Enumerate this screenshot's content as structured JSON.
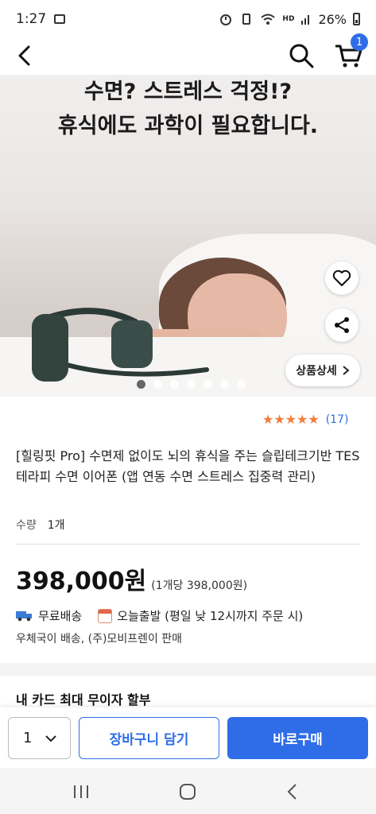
{
  "status_bar": {
    "time": "1:27",
    "battery": "26%",
    "hd_label": "HD"
  },
  "nav": {
    "cart_count": "1"
  },
  "hero": {
    "headline_line1": "수면? 스트레스 걱정!?",
    "headline_line2": "휴식에도 과학이 필요합니다.",
    "detail_button": "상품상세",
    "page_dots": 7,
    "active_dot": 0
  },
  "product": {
    "rating_stars": 5,
    "review_count": "(17)",
    "title": "[힐링핏 Pro] 수면제 없이도 뇌의 휴식을 주는 슬립테크기반 TES 테라피 수면 이어폰 (앱 연동 수면 스트레스 집중력 관리)",
    "qty_label": "수량",
    "qty_value": "1개",
    "price": "398,000원",
    "unit_price": "(1개당 398,000원)",
    "free_shipping": "무료배송",
    "today_ship": "오늘출발 (평일 낮 12시까지 주문 시)",
    "seller": "우체국이 배송, (주)모비프렌이 판매"
  },
  "card_section": {
    "title": "내 카드 최대 무이자 할부"
  },
  "actions": {
    "qty": "1",
    "add_to_cart": "장바구니 담기",
    "buy_now": "바로구매"
  },
  "colors": {
    "accent": "#2f6de8",
    "star": "#f47c3a"
  }
}
